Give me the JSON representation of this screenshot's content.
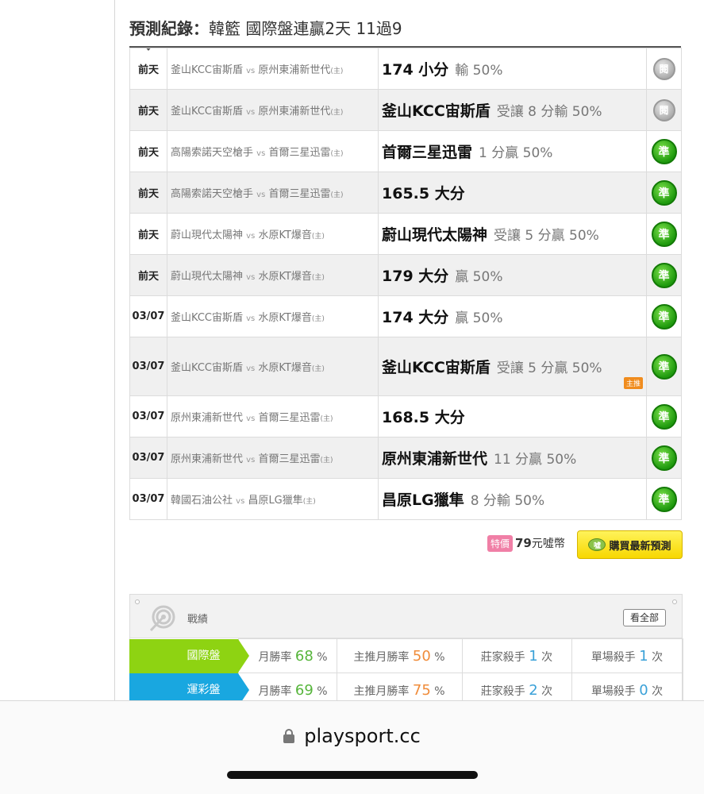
{
  "record": {
    "title_strong": "預測紀錄：",
    "title_rest": "韓籃 國際盤連贏2天 11過9"
  },
  "rows": [
    {
      "date": "前天",
      "home": "釜山KCC宙斯盾",
      "away": "原州東浦新世代",
      "vs": "vs",
      "host_mark": "(主)",
      "pick": "174 小分",
      "detail": "輸 50%",
      "result": "閱",
      "status": "pending",
      "tag": ""
    },
    {
      "date": "前天",
      "home": "釜山KCC宙斯盾",
      "away": "原州東浦新世代",
      "vs": "vs",
      "host_mark": "(主)",
      "pick": "釜山KCC宙斯盾",
      "detail": "受讓 8 分輸 50%",
      "result": "閱",
      "status": "pending",
      "tag": ""
    },
    {
      "date": "前天",
      "home": "高陽索諾天空槍手",
      "away": "首爾三星迅雷",
      "vs": "vs",
      "host_mark": "(主)",
      "pick": "首爾三星迅雷",
      "detail": "1 分贏 50%",
      "result": "準",
      "status": "win",
      "tag": ""
    },
    {
      "date": "前天",
      "home": "高陽索諾天空槍手",
      "away": "首爾三星迅雷",
      "vs": "vs",
      "host_mark": "(主)",
      "pick": "165.5 大分",
      "detail": "",
      "result": "準",
      "status": "win",
      "tag": ""
    },
    {
      "date": "前天",
      "home": "蔚山現代太陽神",
      "away": "水原KT爆音",
      "vs": "vs",
      "host_mark": "(主)",
      "pick": "蔚山現代太陽神",
      "detail": "受讓 5 分贏 50%",
      "result": "準",
      "status": "win",
      "tag": ""
    },
    {
      "date": "前天",
      "home": "蔚山現代太陽神",
      "away": "水原KT爆音",
      "vs": "vs",
      "host_mark": "(主)",
      "pick": "179 大分",
      "detail": "贏 50%",
      "result": "準",
      "status": "win",
      "tag": ""
    },
    {
      "date": "03/07",
      "home": "釜山KCC宙斯盾",
      "away": "水原KT爆音",
      "vs": "vs",
      "host_mark": "(主)",
      "pick": "174 大分",
      "detail": "贏 50%",
      "result": "準",
      "status": "win",
      "tag": ""
    },
    {
      "date": "03/07",
      "home": "釜山KCC宙斯盾",
      "away": "水原KT爆音",
      "vs": "vs",
      "host_mark": "(主)",
      "pick": "釜山KCC宙斯盾",
      "detail": "受讓 5 分贏 50%",
      "result": "準",
      "status": "win",
      "tag": "主推"
    },
    {
      "date": "03/07",
      "home": "原州東浦新世代",
      "away": "首爾三星迅雷",
      "vs": "vs",
      "host_mark": "(主)",
      "pick": "168.5 大分",
      "detail": "",
      "result": "準",
      "status": "win",
      "tag": ""
    },
    {
      "date": "03/07",
      "home": "原州東浦新世代",
      "away": "首爾三星迅雷",
      "vs": "vs",
      "host_mark": "(主)",
      "pick": "原州東浦新世代",
      "detail": "11 分贏 50%",
      "result": "準",
      "status": "win",
      "tag": ""
    },
    {
      "date": "03/07",
      "home": "韓國石油公社",
      "away": "昌原LG獵隼",
      "vs": "vs",
      "host_mark": "(主)",
      "pick": "昌原LG獵隼",
      "detail": "8 分輸 50%",
      "result": "準",
      "status": "win",
      "tag": ""
    }
  ],
  "purchase": {
    "special_tag": "特價",
    "price_num": "79",
    "price_unit": "元噓幣",
    "button_label": "購買最新預測",
    "coin_text": "噓"
  },
  "stats": {
    "label": "戰績",
    "see_all": "看全部",
    "rows": [
      {
        "category": "國際盤",
        "month_label": "月勝率",
        "month_val": "68",
        "month_unit": "%",
        "main_label": "主推月勝率",
        "main_val": "50",
        "main_unit": "%",
        "banker_label": "莊家殺手",
        "banker_val": "1",
        "banker_unit": "次",
        "single_label": "單場殺手",
        "single_val": "1",
        "single_unit": "次"
      },
      {
        "category": "運彩盤",
        "month_label": "月勝率",
        "month_val": "69",
        "month_unit": "%",
        "main_label": "主推月勝率",
        "main_val": "75",
        "main_unit": "%",
        "banker_label": "莊家殺手",
        "banker_val": "2",
        "banker_unit": "次",
        "single_label": "單場殺手",
        "single_val": "0",
        "single_unit": "次"
      }
    ]
  },
  "browser": {
    "url": "playsport.cc"
  },
  "colors": {
    "win_badge": "#1f9a0e",
    "pending_badge": "#a9a9a9",
    "cat_international": "#8ed312",
    "cat_lottery": "#19a7e0",
    "buy_button": "#f7d700",
    "main_tag": "#f08c1e"
  }
}
